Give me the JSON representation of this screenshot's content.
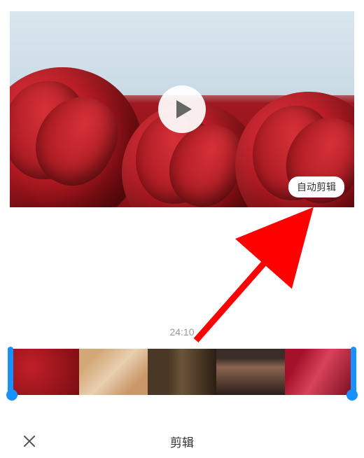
{
  "preview": {
    "auto_edit_label": "自动剪辑",
    "play_icon": "play-icon"
  },
  "timeline": {
    "duration_label": "24:10"
  },
  "bottom": {
    "title": "剪辑",
    "close_icon": "close-icon"
  },
  "annotation": {
    "arrow_color": "#ff0000"
  }
}
